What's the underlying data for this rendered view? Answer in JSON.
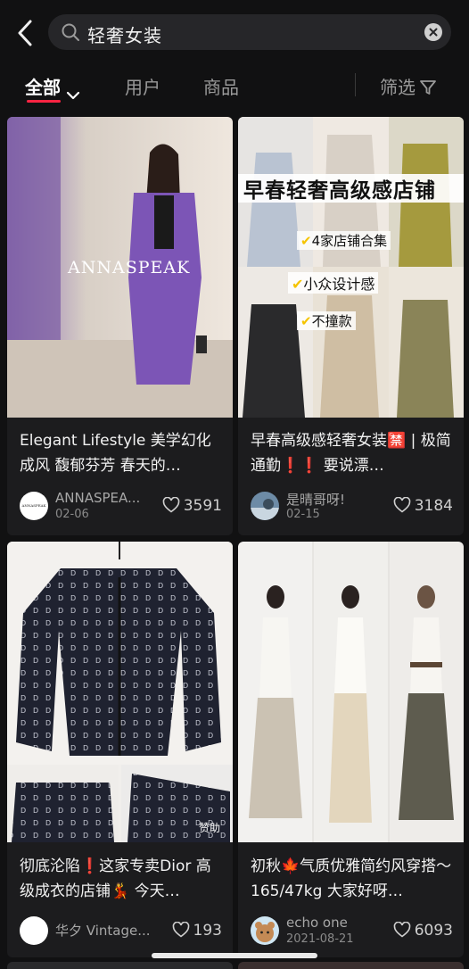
{
  "search": {
    "query": "轻奢女装"
  },
  "tabs": {
    "all": "全部",
    "users": "用户",
    "goods": "商品",
    "filter": "筛选"
  },
  "colors": {
    "accent": "#ff2442",
    "background": "#111112",
    "card": "#1c1c1e"
  },
  "cards": [
    {
      "image_text": "ANNASPEAK",
      "title": "Elegant Lifestyle 美学幻化成风 馥郁芬芳 春天的…",
      "author": "ANNASPEA...",
      "date": "02-06",
      "likes": "3591",
      "avatar_text": "ANNASPEAK"
    },
    {
      "image_headline": "早春轻奢高级感店铺",
      "image_points": [
        "4家店铺合集",
        "小众设计感",
        "不撞款"
      ],
      "title": "早春高级感轻奢女装🈲 | 极简通勤❗❗ 要说漂…",
      "author": "是晴哥呀!",
      "date": "02-15",
      "likes": "3184"
    },
    {
      "image_badge": "赞助",
      "title": "彻底沦陷❗这家专卖Dior 高级成衣的店铺💃 今天…",
      "author": "华夕 Vintage...",
      "date": "",
      "likes": "193"
    },
    {
      "title": "初秋🍁气质优雅简约风穿搭～ 165/47kg 大家好呀…",
      "author": "echo one",
      "date": "2021-08-21",
      "likes": "6093"
    }
  ]
}
